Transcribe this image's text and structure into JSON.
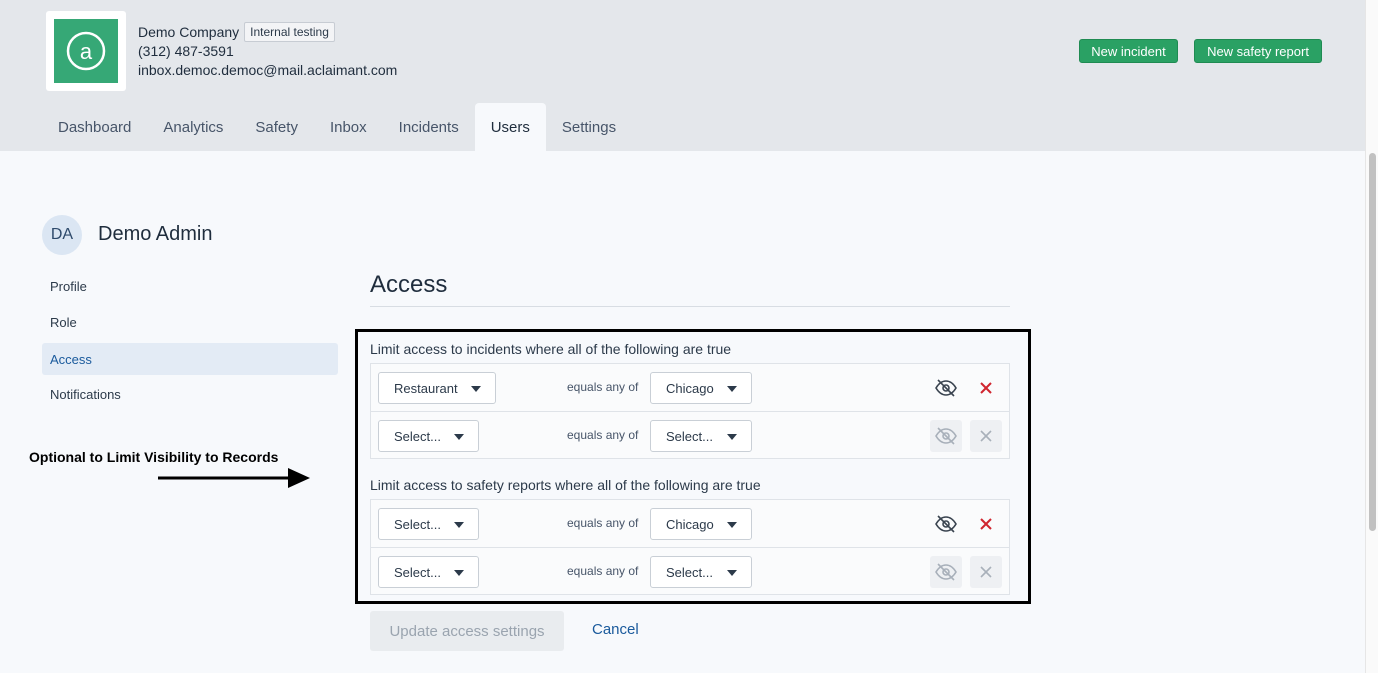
{
  "header": {
    "company_name": "Demo Company",
    "badge": "Internal testing",
    "phone": "(312) 487-3591",
    "email": "inbox.democ.democ@mail.aclaimant.com",
    "new_incident_label": "New incident",
    "new_safety_report_label": "New safety report",
    "brand_color": "#36a876"
  },
  "tabs": [
    {
      "label": "Dashboard"
    },
    {
      "label": "Analytics"
    },
    {
      "label": "Safety"
    },
    {
      "label": "Inbox"
    },
    {
      "label": "Incidents"
    },
    {
      "label": "Users",
      "active": true
    },
    {
      "label": "Settings"
    }
  ],
  "user": {
    "initials": "DA",
    "name": "Demo Admin"
  },
  "sidebar": {
    "items": [
      {
        "label": "Profile"
      },
      {
        "label": "Role"
      },
      {
        "label": "Access",
        "active": true
      },
      {
        "label": "Notifications"
      }
    ]
  },
  "annotation": {
    "text": "Optional to Limit Visibility to Records"
  },
  "access": {
    "title": "Access",
    "incidents_label": "Limit access to incidents where all of the following are true",
    "safety_label": "Limit access to safety reports where all of the following are true",
    "equals_text": "equals any of",
    "incident_rules": [
      {
        "field": "Restaurant",
        "value": "Chicago",
        "enabled": true
      },
      {
        "field": "Select...",
        "value": "Select...",
        "enabled": false
      }
    ],
    "safety_rules": [
      {
        "field": "Select...",
        "value": "Chicago",
        "enabled": true
      },
      {
        "field": "Select...",
        "value": "Select...",
        "enabled": false
      }
    ],
    "update_label": "Update access settings",
    "cancel_label": "Cancel"
  },
  "icons": {
    "hidden": "eye-off-icon",
    "remove": "close-icon",
    "logo": "at-sign-logo-icon"
  }
}
